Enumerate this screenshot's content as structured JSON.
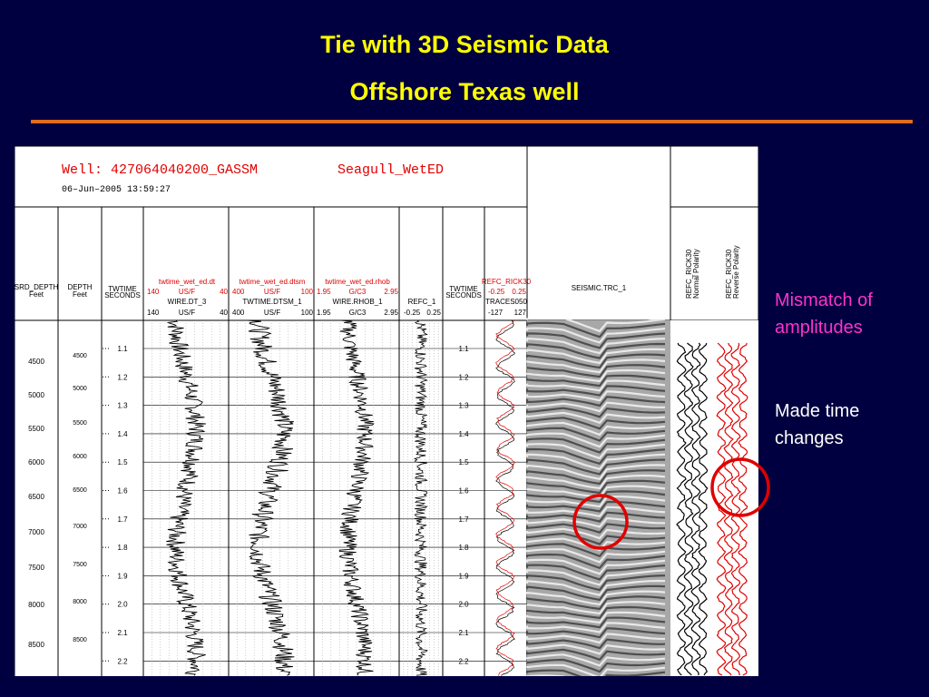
{
  "slide": {
    "title": "Tie with 3D Seismic Data",
    "subtitle": "Offshore Texas well",
    "annotations": [
      "Mismatch of amplitudes",
      "Made time changes"
    ],
    "colors": {
      "background": "#000040",
      "title": "#ffff00",
      "rule": "#e36a1e",
      "annotation1": "#ff33cc",
      "annotation2": "#ffffff",
      "circle": "#e00000"
    }
  },
  "log": {
    "well_label": "Well: 427064040200_GASSM",
    "well_suffix": "Seagull_WetED",
    "date": "06–Jun–2005 13:59:27",
    "tracks": [
      {
        "id": "srd",
        "line1": "SRD_DEPTH",
        "line2": "Feet"
      },
      {
        "id": "depth",
        "line1": "DEPTH",
        "line2": "Feet"
      },
      {
        "id": "twt",
        "line1": "TWTIME",
        "line2": "SECONDS"
      },
      {
        "id": "dt",
        "red": "twtime_wet_ed.dt",
        "red_min": "140",
        "red_unit": "US/F",
        "red_max": "40",
        "name": "WIRE.DT_3",
        "min": "140",
        "unit": "US/F",
        "max": "40"
      },
      {
        "id": "dtsm",
        "red": "twtime_wet_ed.dtsm",
        "red_min": "400",
        "red_unit": "US/F",
        "red_max": "100",
        "name": "TWTIME.DTSM_1",
        "min": "400",
        "unit": "US/F",
        "max": "100"
      },
      {
        "id": "rhob",
        "red": "twtime_wet_ed.rhob",
        "red_min": "1.95",
        "red_unit": "G/C3",
        "red_max": "2.95",
        "name": "WIRE.RHOB_1",
        "min": "1.95",
        "unit": "G/C3",
        "max": "2.95"
      },
      {
        "id": "refc",
        "name": "REFC_1",
        "min": "-0.25",
        "max": "0.25"
      },
      {
        "id": "twt2",
        "line1": "TWTIME",
        "line2": "SECONDS"
      },
      {
        "id": "trace",
        "red": "REFC_RICK30",
        "red_min": "-0.25",
        "red_max": "0.25",
        "name": "TRACES050",
        "min": "-127",
        "max": "127"
      },
      {
        "id": "seismic",
        "name": "SEISMIC.TRC_1"
      },
      {
        "id": "synth",
        "labels": [
          "REFC_RICK30",
          "REFC_RICK30"
        ],
        "sub": [
          "Normal Polarity",
          "Reverse Polarity"
        ]
      }
    ],
    "srd_ticks": [
      "4500",
      "5000",
      "5500",
      "6000",
      "6500",
      "7000",
      "7500",
      "8000",
      "8500"
    ],
    "depth_ticks": [
      "4500",
      "5000",
      "5500",
      "6000",
      "6500",
      "7000",
      "7500",
      "8000",
      "8500"
    ],
    "time_ticks": [
      "1.1",
      "1.2",
      "1.3",
      "1.4",
      "1.5",
      "1.6",
      "1.7",
      "1.8",
      "1.9",
      "2.0",
      "2.1",
      "2.2"
    ]
  }
}
